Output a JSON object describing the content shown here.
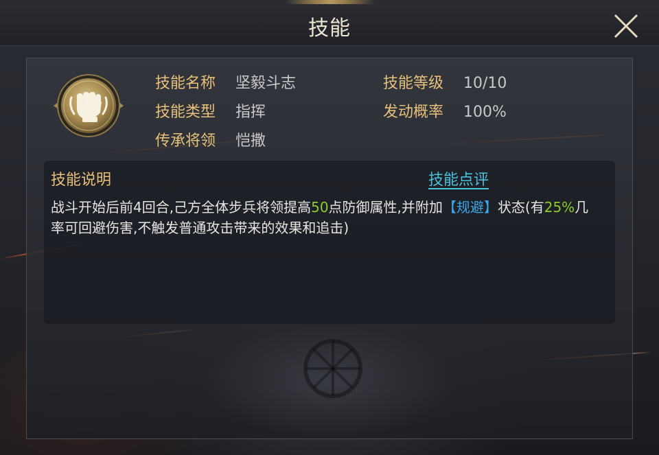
{
  "header": {
    "title": "技能",
    "close_icon": "close-x-icon"
  },
  "skill": {
    "icon": "fist-icon",
    "name_label": "技能名称",
    "name_value": "坚毅斗志",
    "level_label": "技能等级",
    "level_value": "10/10",
    "type_label": "技能类型",
    "type_value": "指挥",
    "trigger_label": "发动概率",
    "trigger_value": "100%",
    "inherit_label": "传承将领",
    "inherit_value": "恺撒"
  },
  "description": {
    "title": "技能说明",
    "review_link": "技能点评",
    "segments": [
      {
        "text": "战斗开始后前4回合,己方全体步兵将领提高",
        "style": "normal"
      },
      {
        "text": "50",
        "style": "green"
      },
      {
        "text": "点防御属性,并附加",
        "style": "normal"
      },
      {
        "text": "【规避】",
        "style": "blue"
      },
      {
        "text": "状态(有",
        "style": "normal"
      },
      {
        "text": "25%",
        "style": "green"
      },
      {
        "text": "几率可回避伤害,不触发普通攻击带来的效果和追击)",
        "style": "normal"
      }
    ]
  },
  "colors": {
    "label_gold": "#e7c07a",
    "value_gray": "#c8c9cc",
    "highlight_green": "#8dcc2e",
    "highlight_blue": "#3aa7e8",
    "link_cyan": "#49c2dc",
    "title_text": "#efe6d2"
  }
}
